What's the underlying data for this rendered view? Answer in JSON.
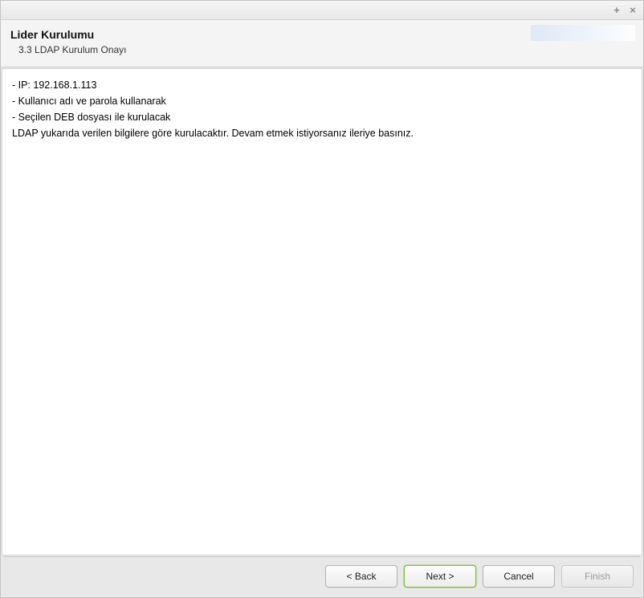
{
  "header": {
    "title": "Lider Kurulumu",
    "subtitle": "3.3 LDAP Kurulum Onayı"
  },
  "content": {
    "lines": [
      "- IP: 192.168.1.113",
      "- Kullanıcı adı ve parola kullanarak",
      "- Seçilen DEB dosyası ile kurulacak",
      "LDAP yukarıda verilen bilgilere göre kurulacaktır. Devam etmek istiyorsanız ileriye basınız."
    ]
  },
  "buttons": {
    "back": "< Back",
    "next": "Next >",
    "cancel": "Cancel",
    "finish": "Finish"
  }
}
